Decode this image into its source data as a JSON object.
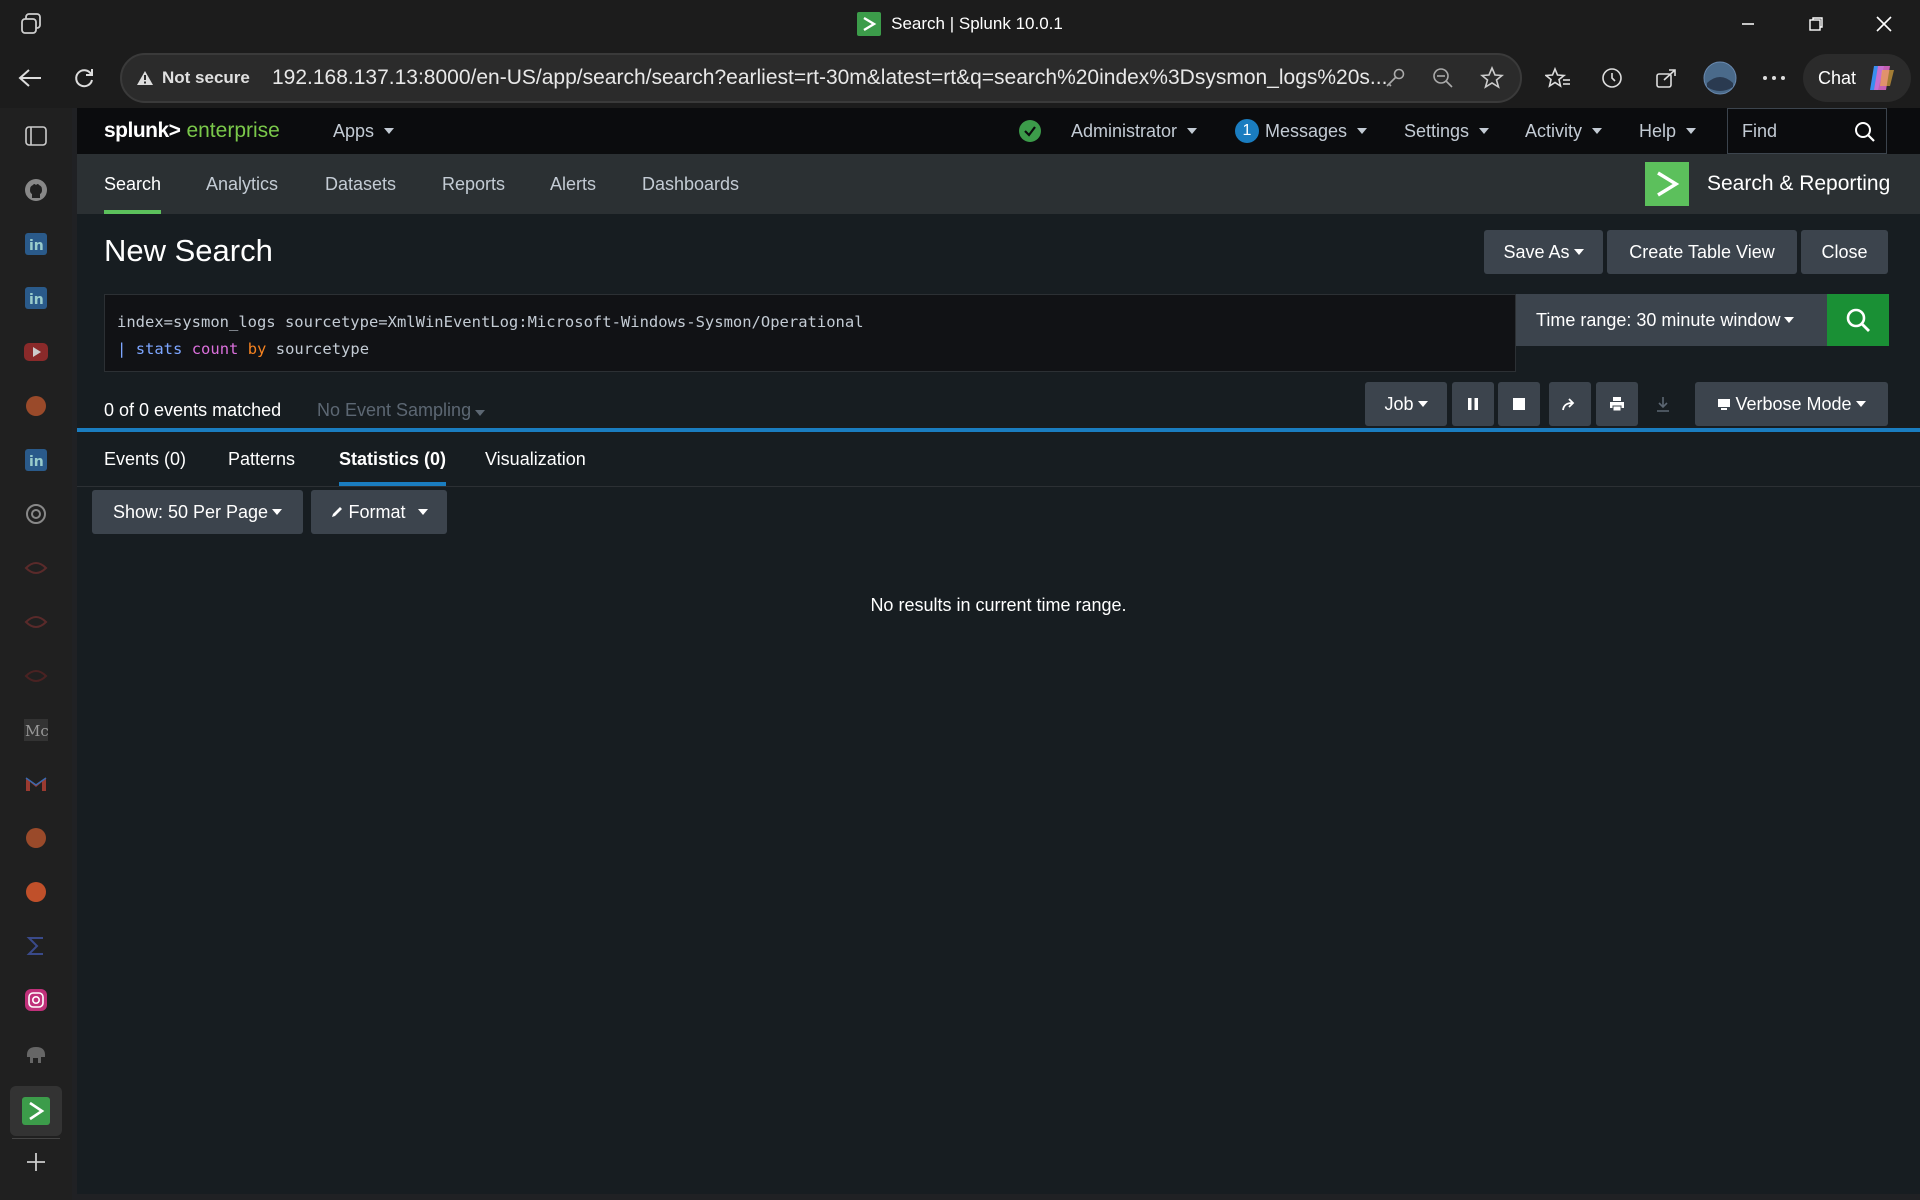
{
  "browser": {
    "tab_title": "Search | Splunk 10.0.1",
    "security_label": "Not secure",
    "url": "192.168.137.13:8000/en-US/app/search/search?earliest=rt-30m&latest=rt&q=search%20index%3Dsysmon_logs%20s...",
    "chat_label": "Chat"
  },
  "splunk": {
    "logo_left": "splunk>",
    "logo_right": "enterprise",
    "system_menu": {
      "apps": "Apps",
      "user": "Administrator",
      "messages_count": "1",
      "messages": "Messages",
      "settings": "Settings",
      "activity": "Activity",
      "help": "Help",
      "find": "Find"
    },
    "app_nav": {
      "tabs": [
        "Search",
        "Analytics",
        "Datasets",
        "Reports",
        "Alerts",
        "Dashboards"
      ],
      "app_name": "Search & Reporting"
    },
    "page": {
      "title": "New Search",
      "save_as": "Save As",
      "create_table_view": "Create Table View",
      "close": "Close"
    },
    "search": {
      "line1": "index=sysmon_logs sourcetype=XmlWinEventLog:Microsoft-Windows-Sysmon/Operational",
      "pipe": "|",
      "cmd": "stats",
      "func": "count",
      "by": "by",
      "field": "sourcetype",
      "time_range": "Time range: 30 minute window"
    },
    "status": {
      "matched": "0 of 0 events matched",
      "sampling": "No Event Sampling",
      "job": "Job",
      "mode": "Verbose Mode"
    },
    "result_tabs": [
      "Events (0)",
      "Patterns",
      "Statistics (0)",
      "Visualization"
    ],
    "controls": {
      "show": "Show: 50 Per Page",
      "format": "Format"
    },
    "empty_message": "No results in current time range."
  },
  "colors": {
    "accent_green": "#5cc05c",
    "search_button": "#1a9035",
    "progress_blue": "#1a7dc0",
    "background": "#171d21"
  }
}
